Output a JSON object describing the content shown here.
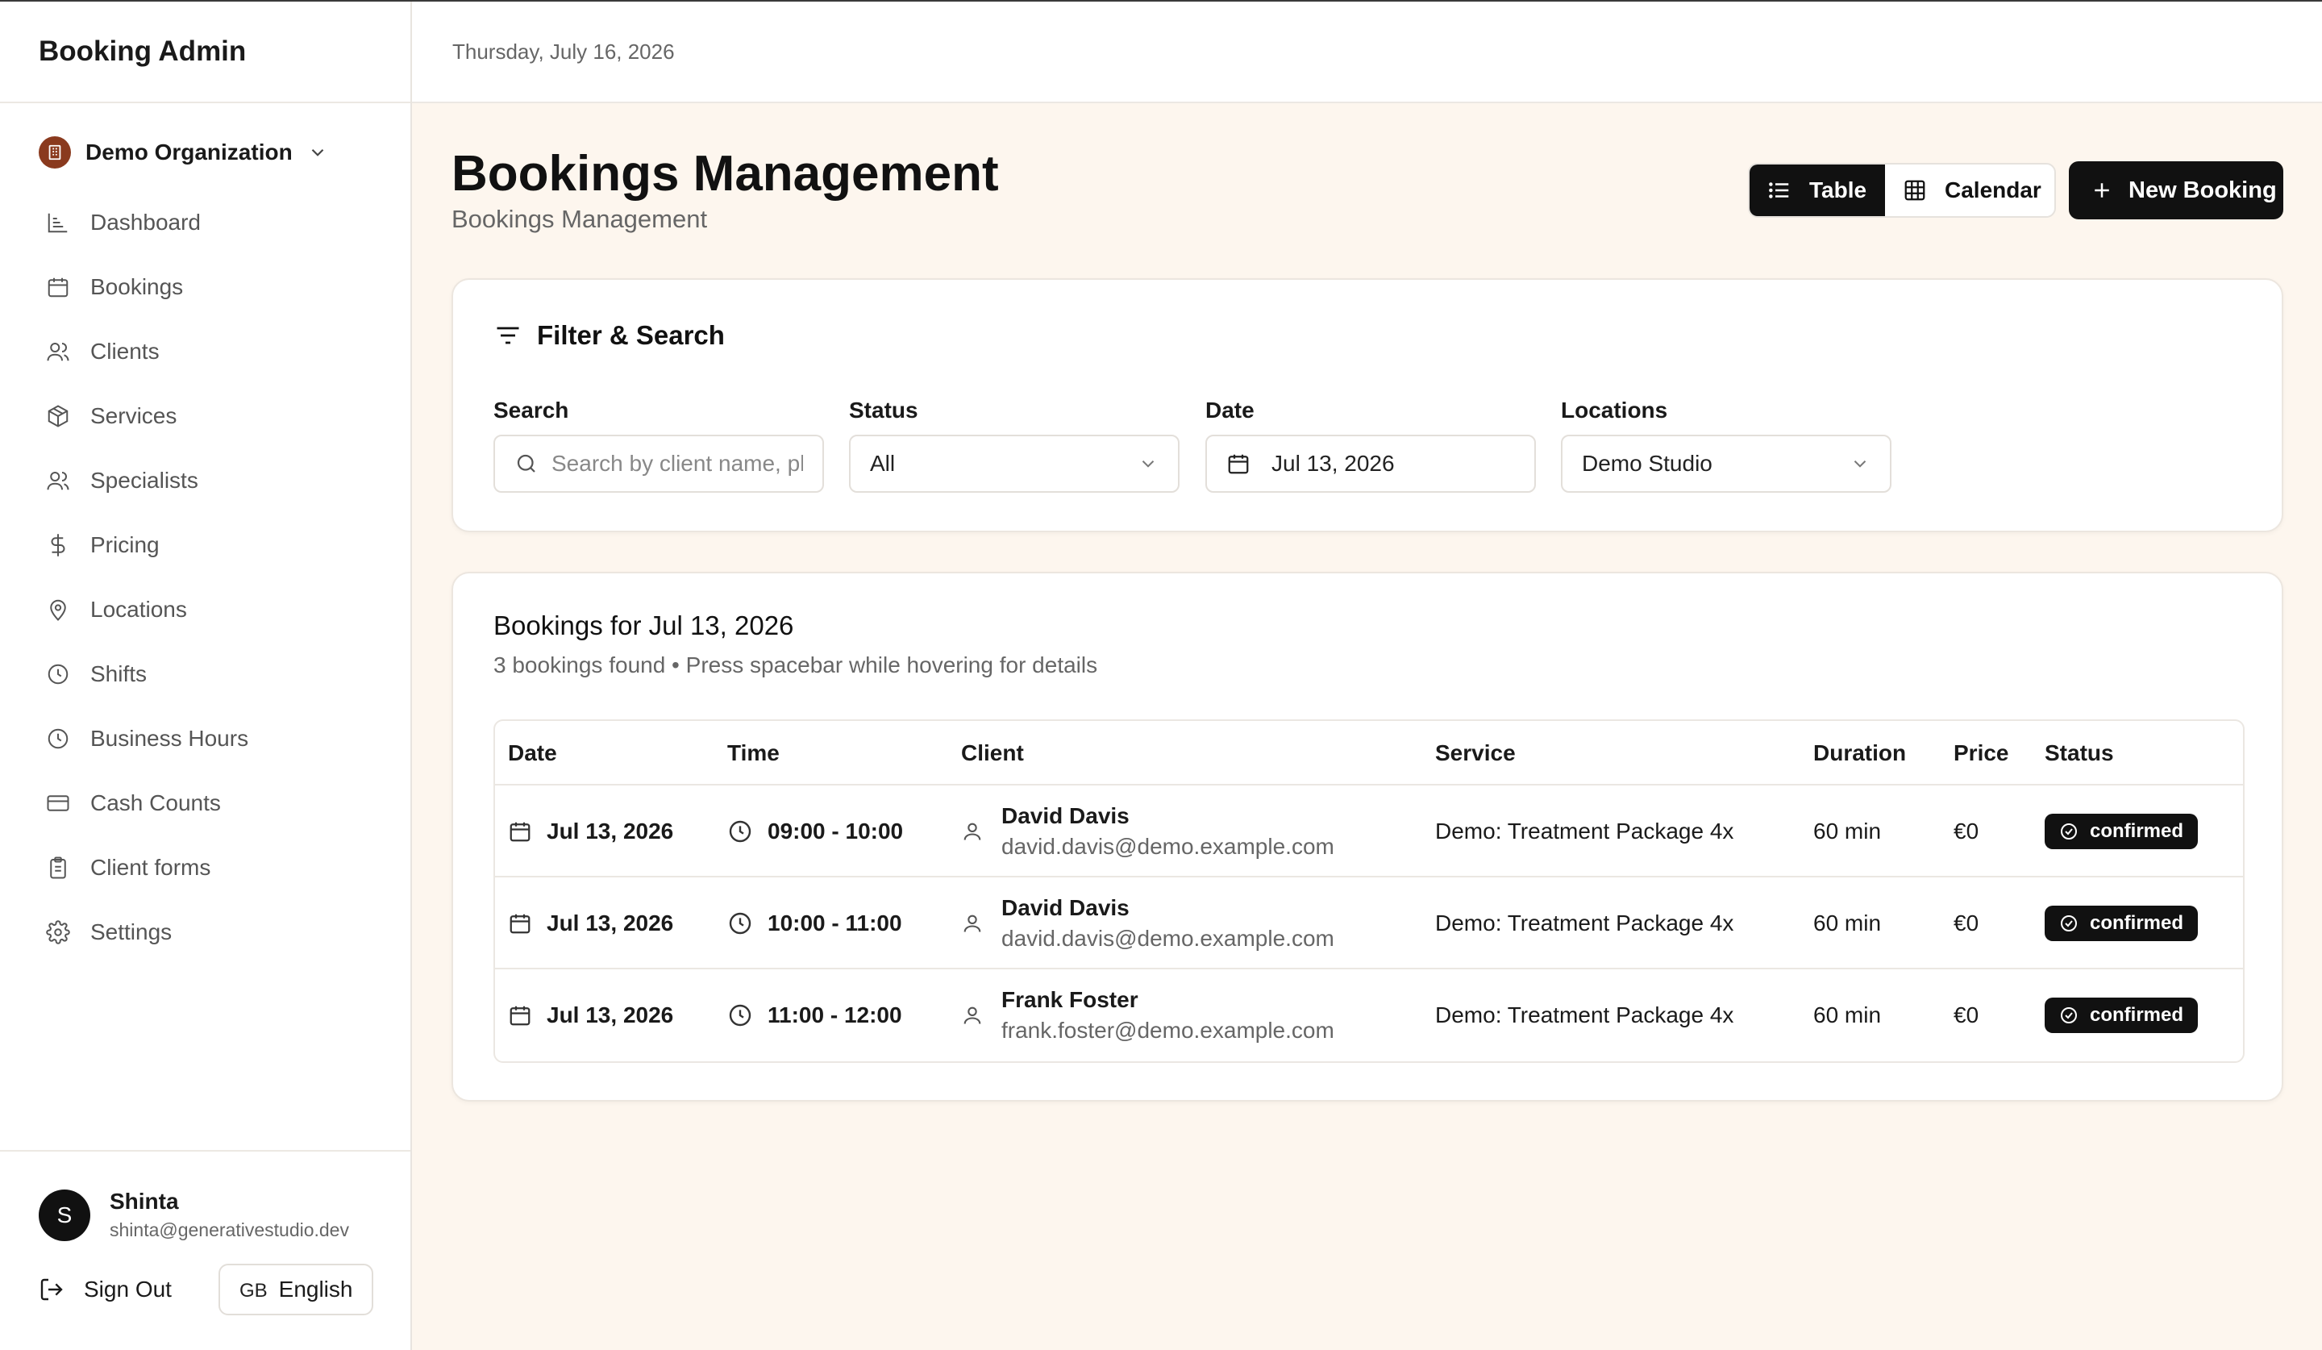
{
  "app": {
    "title": "Booking Admin"
  },
  "organization": {
    "name": "Demo Organization"
  },
  "sidebar": {
    "items": [
      {
        "label": "Dashboard",
        "icon": "chart-icon"
      },
      {
        "label": "Bookings",
        "icon": "calendar-icon"
      },
      {
        "label": "Clients",
        "icon": "users-icon"
      },
      {
        "label": "Services",
        "icon": "package-icon"
      },
      {
        "label": "Specialists",
        "icon": "users-icon"
      },
      {
        "label": "Pricing",
        "icon": "dollar-icon"
      },
      {
        "label": "Locations",
        "icon": "map-pin-icon"
      },
      {
        "label": "Shifts",
        "icon": "clock-icon"
      },
      {
        "label": "Business Hours",
        "icon": "clock-icon"
      },
      {
        "label": "Cash Counts",
        "icon": "credit-card-icon"
      },
      {
        "label": "Client forms",
        "icon": "clipboard-icon"
      },
      {
        "label": "Settings",
        "icon": "gear-icon"
      }
    ]
  },
  "user": {
    "initial": "S",
    "name": "Shinta",
    "email": "shinta@generativestudio.dev"
  },
  "footer": {
    "sign_out": "Sign Out",
    "lang_code": "GB",
    "lang_label": "English"
  },
  "topbar": {
    "date": "Thursday, July 16, 2026"
  },
  "page": {
    "title": "Bookings Management",
    "subtitle": "Bookings Management"
  },
  "view_toggle": {
    "table": "Table",
    "calendar": "Calendar",
    "active": "table"
  },
  "new_booking": "New Booking",
  "filters": {
    "title": "Filter & Search",
    "search": {
      "label": "Search",
      "placeholder": "Search by client name, phone or email"
    },
    "status": {
      "label": "Status",
      "value": "All"
    },
    "date": {
      "label": "Date",
      "value": "Jul 13, 2026"
    },
    "locations": {
      "label": "Locations",
      "value": "Demo Studio"
    }
  },
  "bookings": {
    "title": "Bookings for Jul 13, 2026",
    "subtitle": "3 bookings found • Press spacebar while hovering for details",
    "columns": [
      "Date",
      "Time",
      "Client",
      "Service",
      "Duration",
      "Price",
      "Status"
    ],
    "rows": [
      {
        "date": "Jul 13, 2026",
        "time": "09:00 - 10:00",
        "client_name": "David Davis",
        "client_email": "david.davis@demo.example.com",
        "service": "Demo: Treatment Package 4x",
        "duration": "60 min",
        "price": "€0",
        "status": "confirmed"
      },
      {
        "date": "Jul 13, 2026",
        "time": "10:00 - 11:00",
        "client_name": "David Davis",
        "client_email": "david.davis@demo.example.com",
        "service": "Demo: Treatment Package 4x",
        "duration": "60 min",
        "price": "€0",
        "status": "confirmed"
      },
      {
        "date": "Jul 13, 2026",
        "time": "11:00 - 12:00",
        "client_name": "Frank Foster",
        "client_email": "frank.foster@demo.example.com",
        "service": "Demo: Treatment Package 4x",
        "duration": "60 min",
        "price": "€0",
        "status": "confirmed"
      }
    ]
  },
  "colors": {
    "accent": "#111111",
    "background": "#fdf6ee",
    "org_badge": "#8a3a1e",
    "muted_text": "#666666"
  }
}
